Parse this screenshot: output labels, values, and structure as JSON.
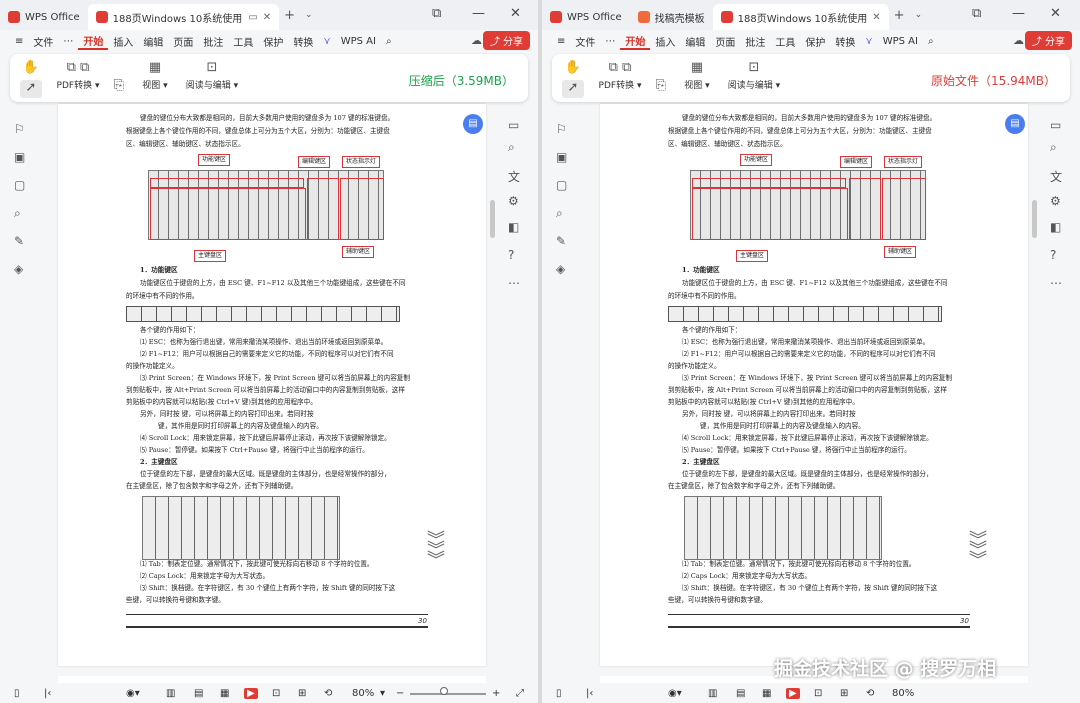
{
  "app": {
    "name": "WPS Office"
  },
  "tabs_left": [
    {
      "label": "WPS Office"
    },
    {
      "label": "188页Windows 10系统使用"
    }
  ],
  "tabs_right": [
    {
      "label": "WPS Office"
    },
    {
      "label": "找稿壳模板"
    },
    {
      "label": "188页Windows 10系统使用"
    }
  ],
  "menu": {
    "file": "文件",
    "more": "⋯",
    "items": [
      "开始",
      "插入",
      "编辑",
      "页面",
      "批注",
      "工具",
      "保护",
      "转换"
    ],
    "ai": "WPS AI",
    "share": "分享"
  },
  "ribbon": {
    "pdf_convert": "PDF转换",
    "view": "视图",
    "read_edit": "阅读与编辑"
  },
  "status_left": {
    "text": "压缩后（3.59MB）",
    "color": "#1aa34a"
  },
  "status_right": {
    "text": "原始文件（15.94MB）",
    "color": "#e03c36"
  },
  "document": {
    "intro": [
      "键盘的键位分布大致都是相同的，目前大多数用户使用的键盘多为 107 键的标准键盘。",
      "根据键盘上各个键位作用的不同，键盘总体上可分为五个大区，分别为：功能键区、主键盘",
      "区、编辑键区、辅助键区、状态指示区。"
    ],
    "labels": {
      "function": "功能键区",
      "edit": "编辑键区",
      "status": "状态指示灯",
      "main": "主键盘区",
      "aux": "辅助键区"
    },
    "sec1_title": "1．功能键区",
    "sec1_text": [
      "功能键区位于键盘的上方，由 ESC 键、F1~F12 以及其他三个功能键组成，这些键在不同",
      "的环境中有不同的作用。"
    ],
    "key_intro": "各个键的作用如下：",
    "keys": [
      "⑴  ESC：也称为强行退出键，常用来撤消某项操作、退出当前环境或返回到原菜单。",
      "⑵  F1~F12：用户可以根据自己的需要来定义它的功能，不同的程序可以对它们有不同",
      "的操作功能定义。",
      "⑶  Print Screen：在 Windows 环境下，按 Print Screen 键可以将当前屏幕上的内容复制",
      "到剪贴板中，按 Alt+Print Screen 可以将当前屏幕上的活动窗口中的内容复制到剪贴板，这样",
      "剪贴板中的内容就可以粘贴(按 Ctrl+V 键)到其他的应用程序中。",
      "另外，同时按                    键，可以将屏幕上的内容打印出来。若同时按",
      "键，其作用是同时打印屏幕上的内容及键盘输入的内容。",
      "⑷  Scroll Lock：用来锁定屏幕，按下此键后屏幕停止滚动，再次按下该键解除锁定。",
      "⑸  Pause：暂停键。如果按下 Ctrl+Pause 键，将强行中止当前程序的运行。"
    ],
    "sec2_title": "2．主键盘区",
    "sec2_text": [
      "位于键盘的左下部，是键盘的最大区域。既是键盘的主体部分，也是经常操作的部分，",
      "在主键盘区，除了包含数字和字母之外，还有下列辅助键。"
    ],
    "aux_keys": [
      "⑴  Tab：制表定位键。通常情况下，按此键可使光标向右移动 8 个字符的位置。",
      "⑵  Caps Lock：用来锁定字母为大写状态。",
      "⑶  Shift：换档键。在字符键区，有 30 个键位上有两个字符，按 Shift 键的同时按下这",
      "些键，可以转换符号键和数字键。"
    ],
    "page_number": "30"
  },
  "statusbar": {
    "zoom": "80%",
    "plus": "+",
    "minus": "−"
  },
  "watermark": "掘金技术社区 @ 搜罗万相"
}
